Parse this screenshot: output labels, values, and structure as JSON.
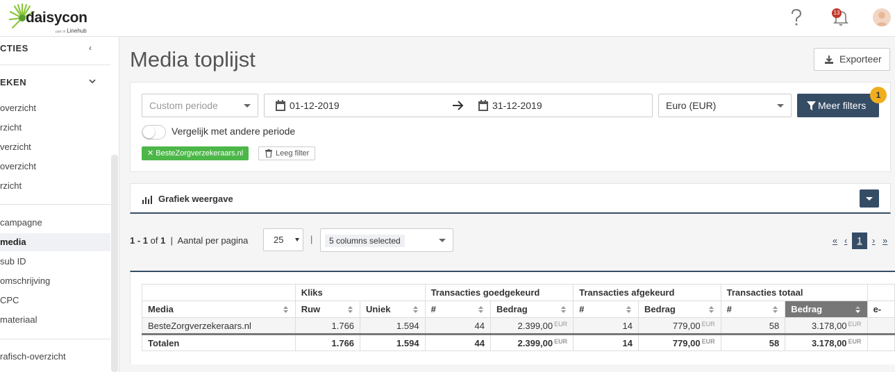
{
  "header": {
    "logo_text": "daisycon",
    "logo_sub_small": "part of",
    "logo_sub": "Linehub",
    "notification_count": "13"
  },
  "sidebar": {
    "section1": "CTIES",
    "section2": "EKEN",
    "items_group1": [
      "overzicht",
      "rzicht",
      "verzicht",
      "overzicht",
      "rzicht"
    ],
    "items_group2": [
      "campagne",
      "media",
      "sub ID",
      "omschrijving",
      "CPC",
      "materiaal"
    ],
    "items_group3": [
      "rafisch-overzicht"
    ],
    "active_item": "media"
  },
  "page": {
    "title": "Media toplijst",
    "export_label": "Exporteer"
  },
  "filters": {
    "period_select": "Custom periode",
    "date_from": "01-12-2019",
    "date_to": "31-12-2019",
    "currency_select": "Euro (EUR)",
    "more_filters_label": "Meer filters",
    "more_filters_count": "1",
    "compare_label": "Vergelijk met andere periode",
    "compare_enabled": false,
    "active_tag": "BesteZorgverzekeraars.nl",
    "clear_label": "Leeg filter"
  },
  "graph": {
    "title": "Grafiek weergave"
  },
  "pager": {
    "range": "1 - 1",
    "of_label": "of",
    "total": "1",
    "per_page_label": "Aantal per pagina",
    "per_page_value": "25",
    "columns_selected": "5 columns selected",
    "first": "«",
    "prev": "‹",
    "current_page": "1",
    "next": "›",
    "last": "»"
  },
  "table": {
    "group_headers": [
      "Kliks",
      "Transacties goedgekeurd",
      "Transacties afgekeurd",
      "Transacties totaal"
    ],
    "columns": [
      "Media",
      "Ruw",
      "Uniek",
      "#",
      "Bedrag",
      "#",
      "Bedrag",
      "#",
      "Bedrag",
      "e-"
    ],
    "currency_suffix": "EUR",
    "rows": [
      {
        "media": "BesteZorgverzekeraars.nl",
        "ruw": "1.766",
        "uniek": "1.594",
        "g_count": "44",
        "g_amount": "2.399,00",
        "a_count": "14",
        "a_amount": "779,00",
        "t_count": "58",
        "t_amount": "3.178,00"
      }
    ],
    "totals": {
      "label": "Totalen",
      "ruw": "1.766",
      "uniek": "1.594",
      "g_count": "44",
      "g_amount": "2.399,00",
      "a_count": "14",
      "a_amount": "779,00",
      "t_count": "58",
      "t_amount": "3.178,00"
    }
  }
}
